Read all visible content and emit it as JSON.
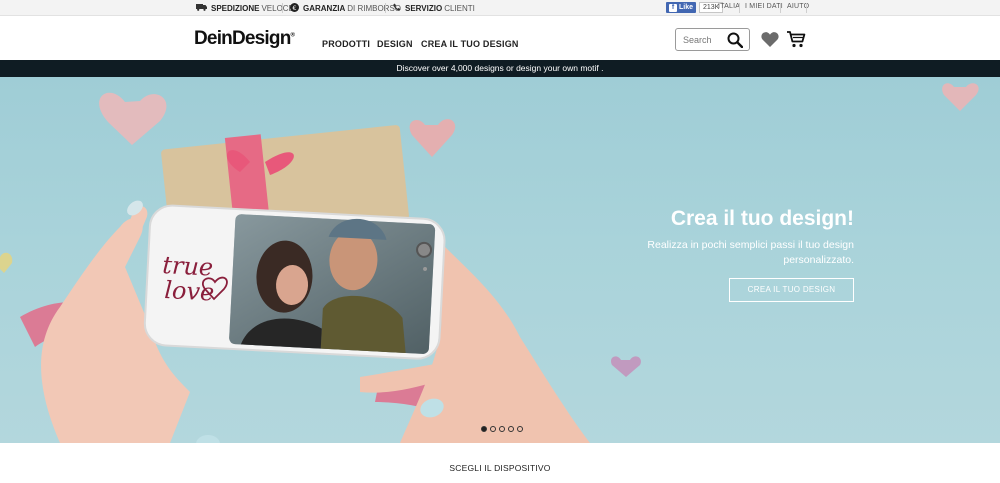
{
  "topbar": {
    "usps": [
      {
        "strong": "SPEDIZIONE",
        "text": "VELOCE",
        "icon": "truck-icon"
      },
      {
        "strong": "GARANZIA",
        "text": "DI RIMBORSO",
        "icon": "euro-icon"
      },
      {
        "strong": "SERVIZIO",
        "text": "CLIENTI",
        "icon": "phone-icon"
      }
    ],
    "facebook": {
      "label": "Like",
      "count": "213K"
    },
    "links": [
      "ITALIA",
      "I MIEI DATI",
      "AIUTO"
    ]
  },
  "header": {
    "logo": "DeinDesign",
    "logo_mark": "®",
    "nav": [
      "PRODOTTI",
      "DESIGN",
      "CREA IL TUO DESIGN"
    ],
    "search_placeholder": "Search"
  },
  "promo": {
    "text": "Discover over 4,000 designs or design your own motif ."
  },
  "hero": {
    "title": "Crea il tuo design!",
    "subtitle": "Realizza in pochi semplici passi il tuo design personalizzato.",
    "button": "CREA IL TUO DESIGN",
    "phone_text_1": "true",
    "phone_text_2": "love",
    "slides": 5,
    "active_slide": 1
  },
  "section": {
    "title": "SCEGLI IL DISPOSITIVO"
  },
  "colors": {
    "promo_bg": "#0f1c23",
    "hero_bg": "#a9d3da",
    "facebook": "#4267b2"
  }
}
